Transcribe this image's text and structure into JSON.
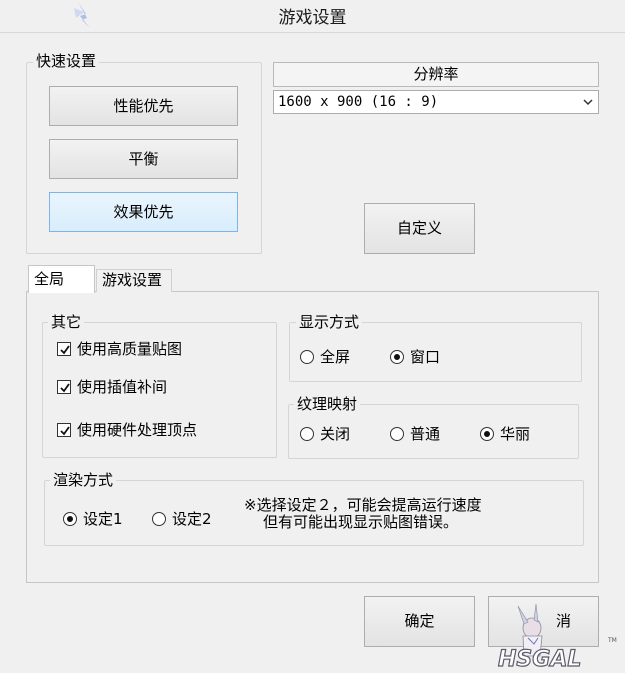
{
  "window": {
    "title": "游戏设置"
  },
  "quick_settings": {
    "label": "快速设置",
    "buttons": [
      {
        "label": "性能优先"
      },
      {
        "label": "平衡"
      },
      {
        "label": "效果优先"
      }
    ]
  },
  "resolution": {
    "label": "分辨率",
    "selected": "1600 x 900 (16 : 9)"
  },
  "custom_button": {
    "label": "自定义"
  },
  "tabs": [
    {
      "label": "全局",
      "active": true
    },
    {
      "label": "游戏设置",
      "active": false
    }
  ],
  "other": {
    "label": "其它",
    "options": [
      {
        "label": "使用高质量贴图",
        "checked": true
      },
      {
        "label": "使用插值补间",
        "checked": true
      },
      {
        "label": "使用硬件处理顶点",
        "checked": true
      }
    ]
  },
  "display_mode": {
    "label": "显示方式",
    "options": [
      {
        "label": "全屏",
        "selected": false
      },
      {
        "label": "窗口",
        "selected": true
      }
    ]
  },
  "texture_mapping": {
    "label": "纹理映射",
    "options": [
      {
        "label": "关闭",
        "selected": false
      },
      {
        "label": "普通",
        "selected": false
      },
      {
        "label": "华丽",
        "selected": true
      }
    ]
  },
  "render_mode": {
    "label": "渲染方式",
    "options": [
      {
        "label": "设定1",
        "selected": true
      },
      {
        "label": "设定2",
        "selected": false
      }
    ],
    "note_line1": "※选择设定２，可能会提高运行速度",
    "note_line2": "但有可能出现显示贴图错误。"
  },
  "footer": {
    "ok_label": "确定",
    "cancel_label_visible": "消"
  },
  "watermark": {
    "text": "HSGAL",
    "tm": "TM"
  }
}
